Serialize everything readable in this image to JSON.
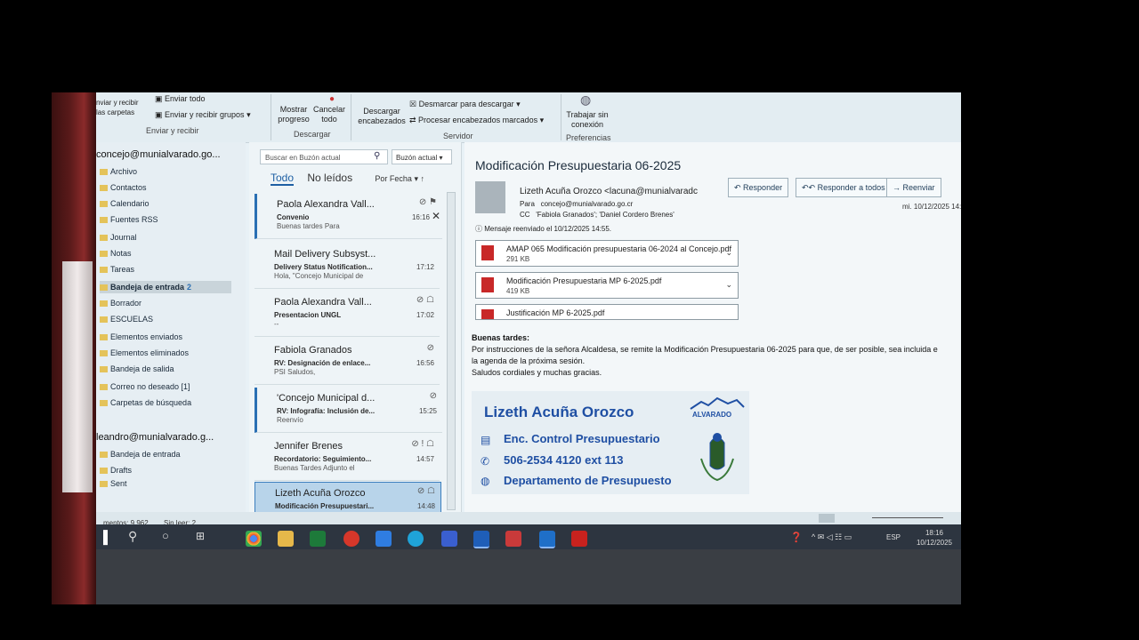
{
  "ribbon": {
    "send_receive_label": "nviar y recibir\nlas carpetas",
    "send_all": "Enviar todo",
    "send_receive_groups": "Enviar y recibir grupos",
    "group_send_receive": "Enviar y recibir",
    "show_progress": "Mostrar progreso",
    "cancel_all": "Cancelar todo",
    "group_download": "Descargar",
    "download_headers": "Descargar encabezados",
    "unmark_download": "Desmarcar para descargar",
    "process_marked_headers": "Procesar encabezados marcados",
    "group_server": "Servidor",
    "work_offline": "Trabajar sin conexión",
    "group_preferences": "Preferencias"
  },
  "folders": {
    "account1": "concejo@munialvarado.go...",
    "items": [
      "Archivo",
      "Contactos",
      "Calendario",
      "Fuentes RSS",
      "Journal",
      "Notas",
      "Tareas",
      "Bandeja de entrada",
      "Borrador",
      "ESCUELAS",
      "Elementos enviados",
      "Elementos eliminados",
      "Bandeja de salida",
      "Correo no deseado [1]",
      "Carpetas de búsqueda"
    ],
    "inbox_count": "2",
    "account2": "leandro@munialvarado.g...",
    "account2_items": [
      "Bandeja de entrada",
      "Drafts",
      "Sent"
    ]
  },
  "msglist": {
    "search_placeholder": "Buscar en Buzón actual",
    "scope": "Buzón actual",
    "tab_all": "Todo",
    "tab_unread": "No leídos",
    "sort": "Por Fecha",
    "messages": [
      {
        "from": "Paola Alexandra Vall...",
        "subject": "Convenio",
        "preview": "Buenas tardes  Para",
        "time": "16:16"
      },
      {
        "from": "Mail Delivery Subsyst...",
        "subject": "Delivery Status Notification...",
        "preview": "Hola, \"Concejo Municipal de",
        "time": "17:12"
      },
      {
        "from": "Paola Alexandra Vall...",
        "subject": "Presentacion UNGL",
        "preview": "--",
        "time": "17:02"
      },
      {
        "from": "Fabiola Granados",
        "subject": "RV: Designación de enlace...",
        "preview": "PSI  Saludos,",
        "time": "16:56"
      },
      {
        "from": "'Concejo Municipal d...",
        "subject": "RV: Infografía: Inclusión de...",
        "preview": "Reenvío",
        "time": "15:25"
      },
      {
        "from": "Jennifer Brenes",
        "subject": "Recordatorio: Seguimiento...",
        "preview": "Buenas Tardes  Adjunto el",
        "time": "14:57"
      },
      {
        "from": "Lizeth Acuña Orozco",
        "subject": "Modificación Presupuestari...",
        "preview": "",
        "time": "14:48"
      }
    ]
  },
  "reading": {
    "subject": "Modificación Presupuestaria 06-2025",
    "sender": "Lizeth Acuña Orozco <lacuna@munialvaradc",
    "to_label": "Para",
    "to": "concejo@munialvarado.go.cr",
    "cc_label": "CC",
    "cc": "'Fabiola Granados'; 'Daniel Cordero Brenes'",
    "forwarded_note": "Mensaje reenviado el 10/12/2025 14:55.",
    "date": "mi. 10/12/2025 14:",
    "reply": "Responder",
    "reply_all": "Responder a todos",
    "forward": "Reenviar",
    "attachments": [
      {
        "name": "AMAP 065 Modificación presupuestaria 06-2024 al Concejo.pdf",
        "size": "291 KB"
      },
      {
        "name": "Modificación Presupuestaria MP 6-2025.pdf",
        "size": "419 KB"
      },
      {
        "name": "Justificación MP 6-2025.pdf",
        "size": ""
      }
    ],
    "body": [
      "Buenas tardes:",
      "Por instrucciones de la señora Alcaldesa, se remite la Modificación Presupuestaria 06-2025 para que, de ser posible, sea incluida e",
      "la agenda de la próxima sesión.",
      "Saludos cordiales y muchas gracias."
    ],
    "signature": {
      "name": "Lizeth Acuña Orozco",
      "role": "Enc. Control Presupuestario",
      "phone": "506-2534 4120  ext 113",
      "department": "Departamento de Presupuesto",
      "logo_text": "ALVARADO"
    }
  },
  "status": {
    "items": "mentos: 9.962",
    "unread": "Sin leer: 2"
  },
  "taskbar": {
    "time": "18:16",
    "date": "10/12/2025",
    "lang": "ESP"
  }
}
